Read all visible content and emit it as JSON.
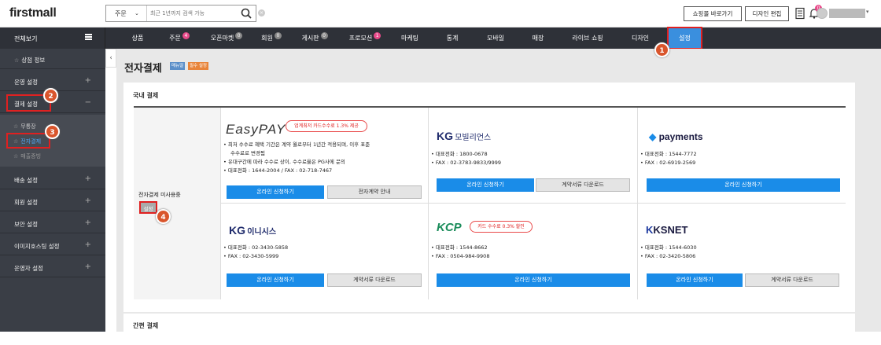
{
  "header": {
    "logo": "firstmall",
    "search_scope": "주문",
    "search_placeholder": "최근 1년까지 검색 가능",
    "btn_shop": "쇼핑몰 바로가기",
    "btn_design": "디자인 편집",
    "notif_count": "0"
  },
  "nav": {
    "all_label": "전체보기",
    "items": [
      {
        "label": "상품",
        "badge": ""
      },
      {
        "label": "주문",
        "badge": "4"
      },
      {
        "label": "오픈마켓",
        "badge": "0"
      },
      {
        "label": "회원",
        "badge": "0"
      },
      {
        "label": "게시판",
        "badge": "0"
      },
      {
        "label": "프로모션",
        "badge": "1"
      },
      {
        "label": "마케팅",
        "badge": ""
      },
      {
        "label": "통계",
        "badge": ""
      },
      {
        "label": "모바일",
        "badge": ""
      },
      {
        "label": "매장",
        "badge": ""
      },
      {
        "label": "라이브 쇼핑",
        "badge": ""
      },
      {
        "label": "디자인",
        "badge": ""
      },
      {
        "label": "설정",
        "badge": ""
      }
    ]
  },
  "sidebar": {
    "items": [
      "상점 정보",
      "운영 설정",
      "결제 설정",
      "배송 설정",
      "회원 설정",
      "보안 설정",
      "이미지호스팅 설정",
      "운영자 설정"
    ],
    "sub_items": [
      "무통장",
      "전자결제",
      "매출증빙"
    ]
  },
  "page": {
    "title": "전자결제",
    "tag_manual": "매뉴얼",
    "tag_required": "필수 설정",
    "section_domestic": "국내 결제",
    "section_simple": "간편 결제",
    "status_label": "전자결제 미사용중",
    "setting_button": "설정"
  },
  "providers": {
    "easypay": {
      "name": "EasyPAY",
      "promo": "업계최저 카드수수료 1.3% 제공",
      "lines": [
        "최저 수수료 혜택 기간은 계약 월로부터 1년간 적용되며, 이후 표준",
        "수수료로 변경됨",
        "유대구간에 따라 수수료 상이, 수수료율은 PG사에 문의",
        "대표전화 : 1644-2004 / FAX : 02-718-7467"
      ],
      "btn_apply": "온라인 신청하기",
      "btn_info": "전자계약 안내"
    },
    "kgmobilians": {
      "name_kg": "KG",
      "name": "모빌리언스",
      "lines": [
        "대표전화 : 1800-0678",
        "FAX      : 02-3783-9833/9999"
      ],
      "btn_apply": "온라인 신청하기",
      "btn_doc": "계약서류 다운로드"
    },
    "payments": {
      "name": "payments",
      "lines": [
        "대표전화 : 1544-7772",
        "FAX      : 02-6919-2569"
      ],
      "btn_apply": "온라인 신청하기"
    },
    "kginicis": {
      "name_kg": "KG",
      "name": "이니시스",
      "lines": [
        "대표전화 : 02-3430-5858",
        "FAX      : 02-3430-5999"
      ],
      "btn_apply": "온라인 신청하기",
      "btn_doc": "계약서류 다운로드"
    },
    "kcp": {
      "name": "KCP",
      "promo": "카드 수수료 0.3% 할인",
      "lines": [
        "대표전화 : 1544-8662",
        "FAX      : 0504-984-9908"
      ],
      "btn_apply": "온라인 신청하기"
    },
    "ksnet": {
      "name": "KSNET",
      "lines": [
        "대표전화 : 1544-6030",
        "FAX      : 02-3420-5806"
      ],
      "btn_apply": "온라인 신청하기",
      "btn_doc": "계약서류 다운로드"
    }
  },
  "steps": [
    "1",
    "2",
    "3",
    "4"
  ]
}
